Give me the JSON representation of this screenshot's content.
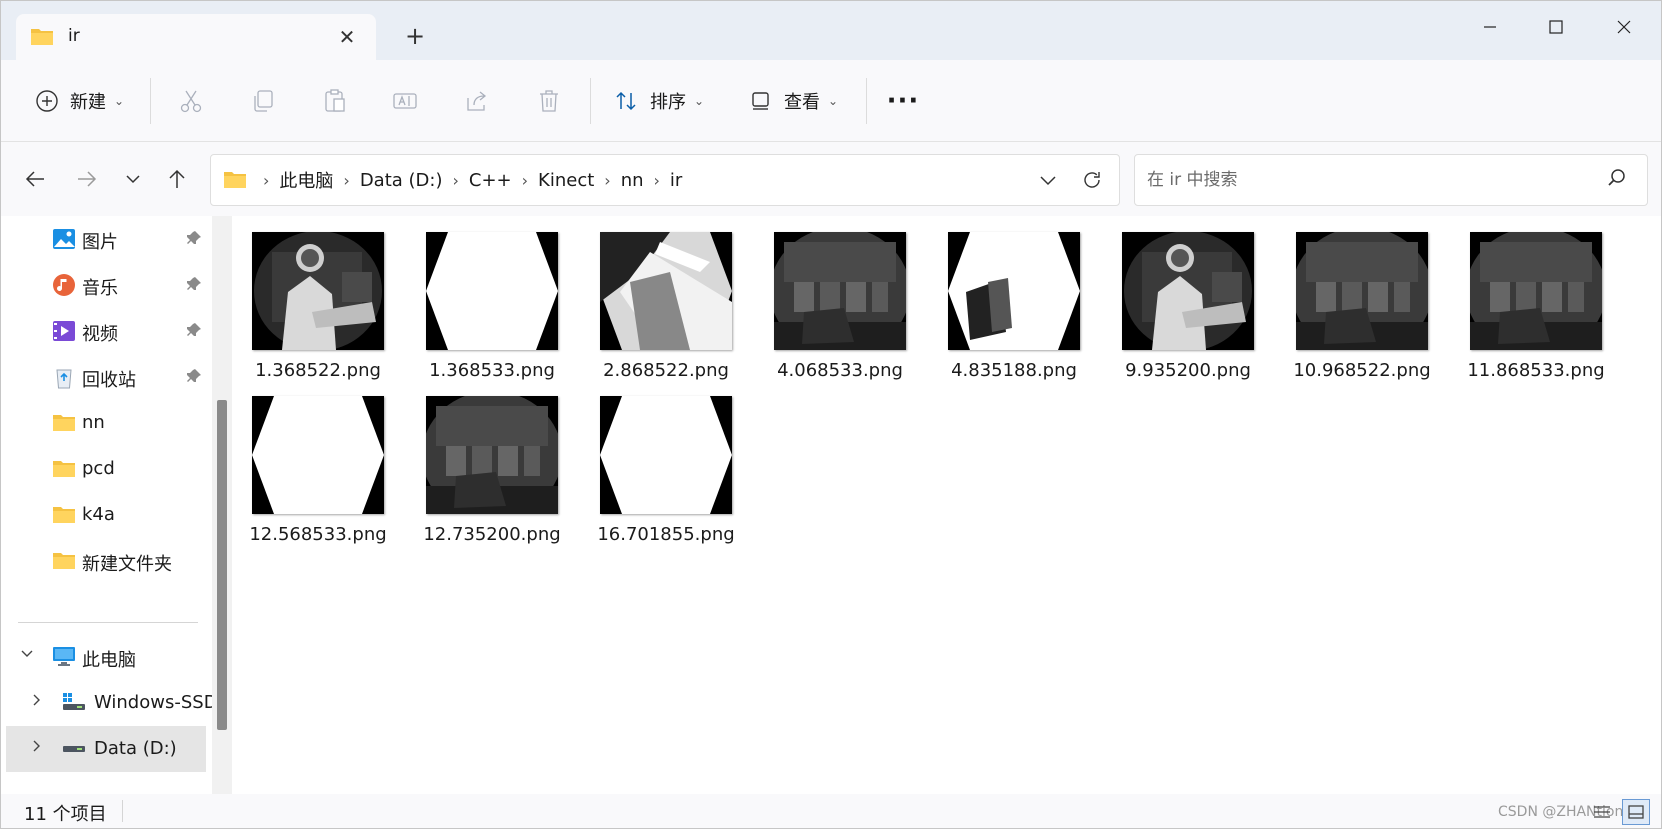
{
  "window": {
    "tab_title": "ir",
    "tab_close": "✕",
    "new_tab": "+",
    "minimize": "—",
    "maximize": "☐",
    "close": "✕"
  },
  "toolbar": {
    "new_label": "新建",
    "sort_label": "排序",
    "view_label": "查看",
    "more": "···"
  },
  "address": {
    "crumbs": [
      "此电脑",
      "Data (D:)",
      "C++",
      "Kinect",
      "nn",
      "ir"
    ]
  },
  "search": {
    "placeholder": "在 ir 中搜索"
  },
  "sidebar": {
    "quick": [
      {
        "label": "图片",
        "icon": "pictures-icon",
        "pinned": true
      },
      {
        "label": "音乐",
        "icon": "music-icon",
        "pinned": true
      },
      {
        "label": "视频",
        "icon": "videos-icon",
        "pinned": true
      },
      {
        "label": "回收站",
        "icon": "recycle-bin-icon",
        "pinned": true
      },
      {
        "label": "nn",
        "icon": "folder-icon"
      },
      {
        "label": "pcd",
        "icon": "folder-icon"
      },
      {
        "label": "k4a",
        "icon": "folder-icon"
      },
      {
        "label": "新建文件夹",
        "icon": "folder-icon"
      }
    ],
    "this_pc": "此电脑",
    "drives": [
      "Windows-SSD",
      "Data (D:)"
    ]
  },
  "files": [
    {
      "name": "1.368522.png",
      "kind": "person"
    },
    {
      "name": "1.368533.png",
      "kind": "white"
    },
    {
      "name": "2.868522.png",
      "kind": "bright"
    },
    {
      "name": "4.068533.png",
      "kind": "room"
    },
    {
      "name": "4.835188.png",
      "kind": "whiteobj"
    },
    {
      "name": "9.935200.png",
      "kind": "person"
    },
    {
      "name": "10.968522.png",
      "kind": "room"
    },
    {
      "name": "11.868533.png",
      "kind": "room"
    },
    {
      "name": "12.568533.png",
      "kind": "white"
    },
    {
      "name": "12.735200.png",
      "kind": "room"
    },
    {
      "name": "16.701855.png",
      "kind": "white"
    }
  ],
  "status": {
    "item_count": "11 个项目",
    "watermark": "CSDN @ZHANtiontai"
  },
  "colors": {
    "accent": "#0067c0",
    "folder": "#f5c242"
  }
}
